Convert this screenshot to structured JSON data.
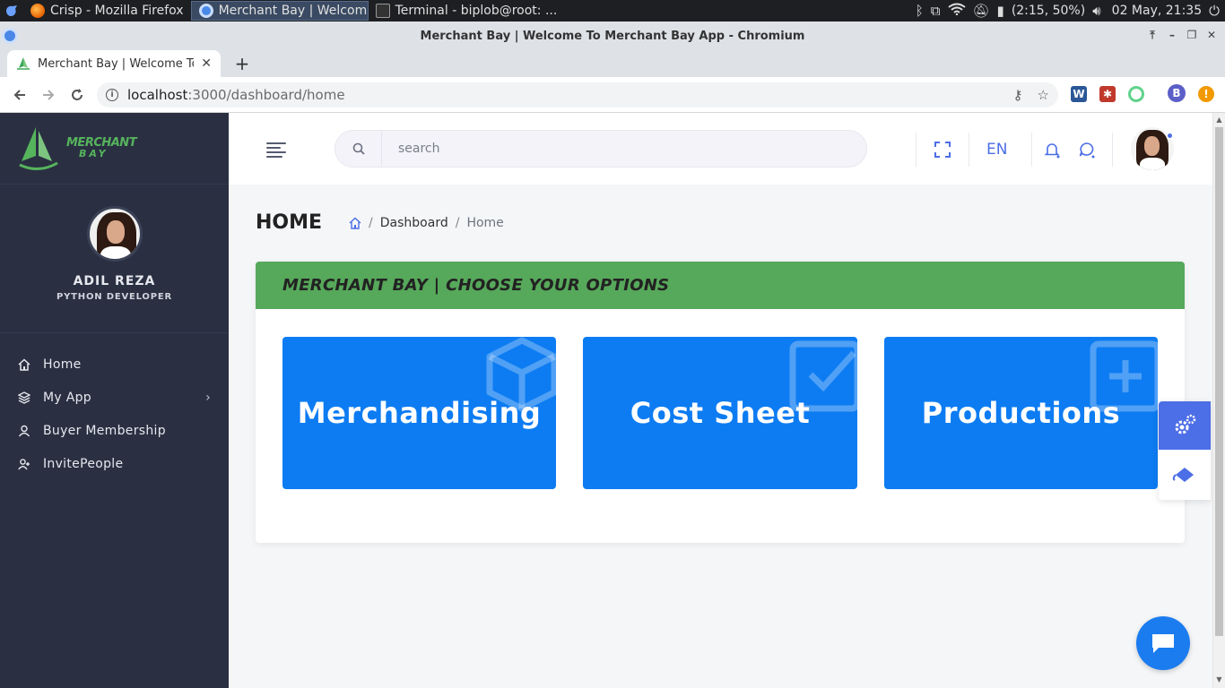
{
  "os": {
    "tasks": [
      {
        "label": "Crisp - Mozilla Firefox"
      },
      {
        "label": "Merchant Bay | Welcom..."
      },
      {
        "label": "Terminal - biplob@root: ..."
      }
    ],
    "battery": "(2:15, 50%)",
    "clock": "02 May, 21:35"
  },
  "browser": {
    "window_title": "Merchant Bay | Welcome To Merchant Bay App - Chromium",
    "tab_title": "Merchant Bay | Welcome To Merchant Bay App",
    "url_host": "localhost",
    "url_path": ":3000/dashboard/home",
    "profile_initial": "B",
    "ext_w_label": "W"
  },
  "sidebar": {
    "logo_line1": "MERCHANT",
    "logo_line2": "BAY",
    "user_name": "ADIL REZA",
    "user_role": "PYTHON DEVELOPER",
    "items": [
      {
        "label": "Home",
        "icon": "home-icon"
      },
      {
        "label": "My App",
        "icon": "layers-icon"
      },
      {
        "label": "Buyer Membership",
        "icon": "user-icon"
      },
      {
        "label": "InvitePeople",
        "icon": "user-plus-icon"
      }
    ]
  },
  "header": {
    "search_placeholder": "search",
    "language": "EN"
  },
  "page": {
    "title": "HOME",
    "breadcrumb": [
      "Dashboard",
      "Home"
    ]
  },
  "options_card": {
    "heading": "MERCHANT BAY | CHOOSE YOUR OPTIONS",
    "options": [
      {
        "label": "Merchandising",
        "icon": "cube-icon"
      },
      {
        "label": "Cost Sheet",
        "icon": "checkbox-icon"
      },
      {
        "label": "Productions",
        "icon": "plus-square-icon"
      }
    ]
  },
  "colors": {
    "sidebar_bg": "#2a3042",
    "accent_blue": "#4c6ee6",
    "option_blue": "#0d7cf2",
    "card_head_green": "#56a85a"
  }
}
